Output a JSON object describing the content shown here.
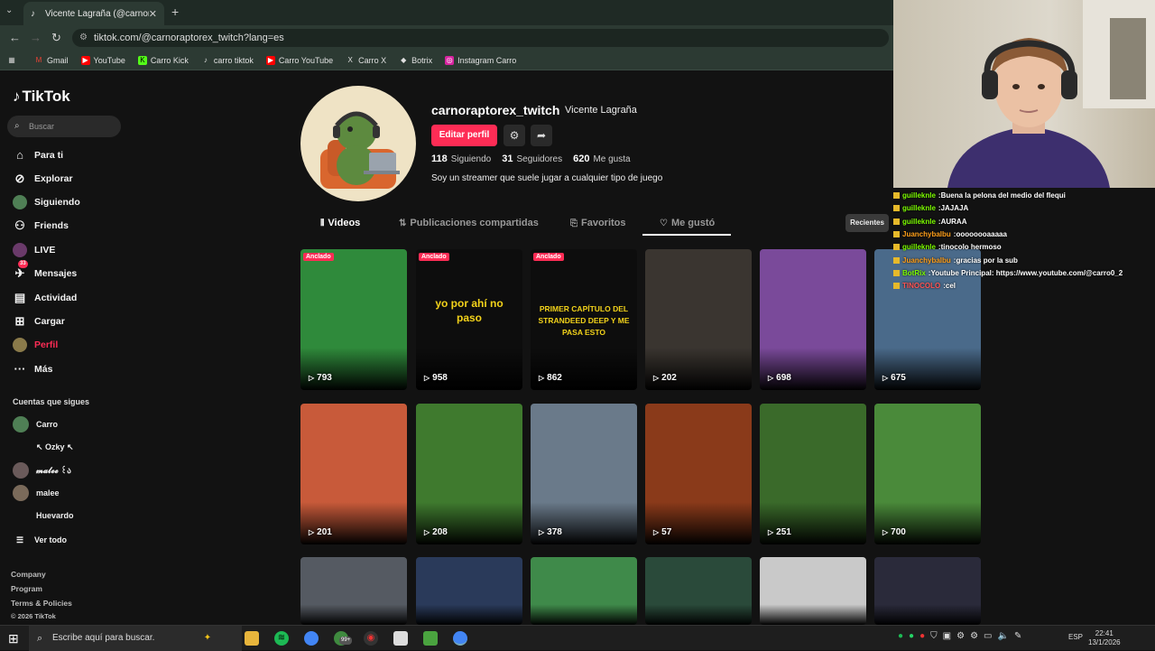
{
  "browser": {
    "tab_title": "Vicente Lagraña (@carnoraptor",
    "url": "tiktok.com/@carnoraptorex_twitch?lang=es",
    "bookmarks": [
      "Gmail",
      "YouTube",
      "Carro Kick",
      "carro tiktok",
      "Carro YouTube",
      "Carro X",
      "Botrix",
      "Instagram Carro"
    ]
  },
  "sidebar": {
    "logo": "TikTok",
    "search_placeholder": "Buscar",
    "nav": [
      "Para ti",
      "Explorar",
      "Siguiendo",
      "Friends",
      "LIVE",
      "Mensajes",
      "Actividad",
      "Cargar",
      "Perfil",
      "Más"
    ],
    "messages_badge": "33",
    "following_title": "Cuentas que sigues",
    "accounts": [
      "Carro",
      "↖︎ Ozky ↖︎",
      "𝓶𝓪𝓵𝓮𝓮 ꒰ა",
      "malee",
      "Huevardo"
    ],
    "see_all": "Ver todo",
    "footer": [
      "Company",
      "Program",
      "Terms & Policies",
      "© 2026 TikTok"
    ]
  },
  "profile": {
    "username": "carnoraptorex_twitch",
    "nickname": "Vicente Lagraña",
    "edit_label": "Editar perfil",
    "following_count": "118",
    "following_label": "Siguiendo",
    "followers_count": "31",
    "followers_label": "Seguidores",
    "likes_count": "620",
    "likes_label": "Me gusta",
    "bio": "Soy un streamer que suele jugar a cualquier tipo de juego"
  },
  "tabs": [
    "Videos",
    "Publicaciones compartidas",
    "Favoritos",
    "Me gustó"
  ],
  "sort_label": "Recientes",
  "pinned_label": "Anclado",
  "videos": [
    {
      "views": "793",
      "pinned": true,
      "color": "#2f8a3b"
    },
    {
      "views": "958",
      "pinned": true,
      "color": "#0d0d0d",
      "caption": "yo por ahí no paso",
      "caption_color": "#f2d21a"
    },
    {
      "views": "862",
      "pinned": true,
      "color": "#0d0d0d",
      "caption": "PRIMER CAPÍTULO DEL STRANDEED DEEP Y ME PASA ESTO",
      "caption_color": "#f2d21a"
    },
    {
      "views": "202",
      "pinned": false,
      "color": "#3a3530"
    },
    {
      "views": "698",
      "pinned": false,
      "color": "#7a4a9a"
    },
    {
      "views": "675",
      "pinned": false,
      "color": "#4a6a8a"
    },
    {
      "views": "201",
      "pinned": false,
      "color": "#c85a3a"
    },
    {
      "views": "208",
      "pinned": false,
      "color": "#3f7a2e"
    },
    {
      "views": "378",
      "pinned": false,
      "color": "#6a7a8a"
    },
    {
      "views": "57",
      "pinned": false,
      "color": "#8a3a1a"
    },
    {
      "views": "251",
      "pinned": false,
      "color": "#3a6a2a"
    },
    {
      "views": "700",
      "pinned": false,
      "color": "#4a8a3a"
    },
    {
      "color": "#555a62"
    },
    {
      "color": "#2a3a5a"
    },
    {
      "color": "#3f8a4a"
    },
    {
      "color": "#2a4a3a"
    },
    {
      "color": "#c9c9c9"
    },
    {
      "color": "#2a2a3a"
    }
  ],
  "chat": [
    {
      "user": "guilleknle",
      "msg": "Buena la pelona del medio del flequi",
      "color": "#7cfc00"
    },
    {
      "user": "guilleknle",
      "msg": "JAJAJA",
      "color": "#7cfc00"
    },
    {
      "user": "guilleknle",
      "msg": "AURAA",
      "color": "#7cfc00"
    },
    {
      "user": "Juanchybalbu",
      "msg": "oooooooaaaaa",
      "color": "#ff9f1a"
    },
    {
      "user": "guilleknle",
      "msg": "tinocolo hermoso",
      "color": "#7cfc00"
    },
    {
      "user": "Juanchybalbu",
      "msg": "gracias por la sub",
      "color": "#ff9f1a"
    },
    {
      "user": "BotRix",
      "msg": "Youtube Principal: https://www.youtube.com/@carro0_2",
      "color": "#7cfc00"
    },
    {
      "user": "TINOCOLO",
      "msg": "cel",
      "color": "#ff5555"
    }
  ],
  "taskbar": {
    "search_placeholder": "Escribe aquí para buscar.",
    "badge": "99+",
    "lang": "ESP",
    "time": "22:41",
    "date": "13/1/2026"
  }
}
